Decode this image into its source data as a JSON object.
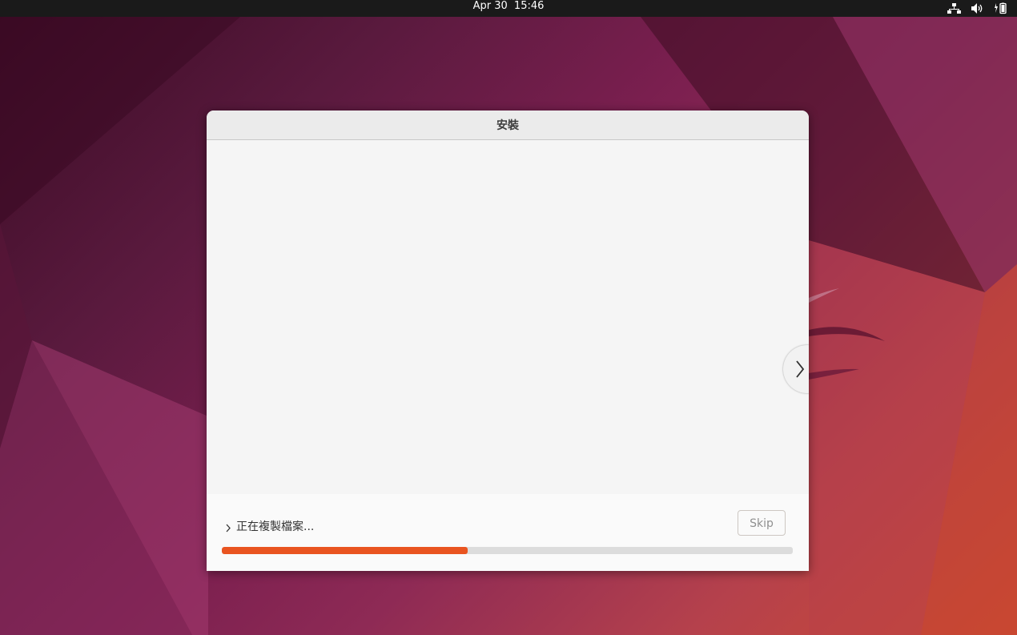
{
  "topbar": {
    "date": "Apr 30",
    "time": "15:46",
    "icons": [
      "network-wired-icon",
      "volume-icon",
      "battery-icon"
    ]
  },
  "window": {
    "title": "安裝",
    "next_slide_icon": "chevron-right-icon"
  },
  "footer": {
    "expander_icon": "chevron-right-icon",
    "status": "正在複製檔案...",
    "skip_label": "Skip",
    "skip_enabled": false,
    "progress": 0.43
  },
  "colors": {
    "accent": "#e95420",
    "topbar": "#1a1a1a",
    "titlebar": "#ebebeb"
  }
}
